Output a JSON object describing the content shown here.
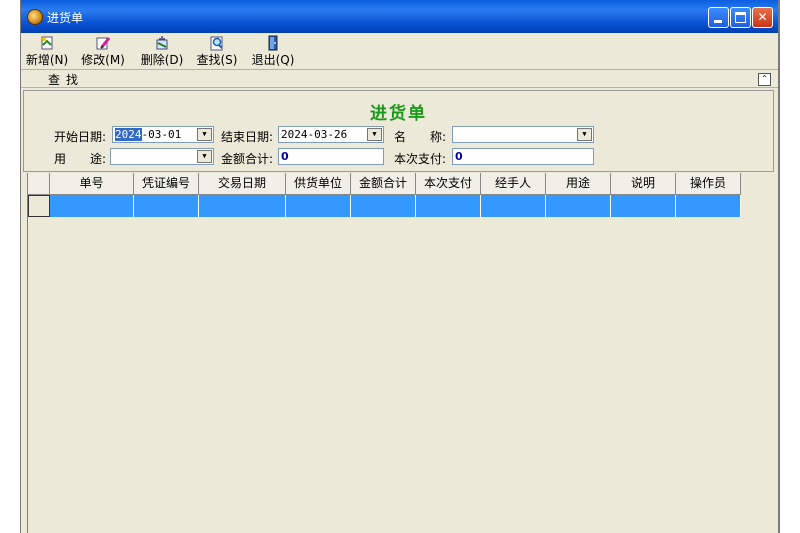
{
  "window": {
    "title": "进货单"
  },
  "toolbar": [
    {
      "name": "new",
      "label": "新增(N)",
      "icon": "new-doc-icon"
    },
    {
      "name": "edit",
      "label": "修改(M)",
      "icon": "edit-pencil-icon"
    },
    {
      "name": "delete",
      "label": "删除(D)",
      "icon": "delete-icon"
    },
    {
      "name": "search",
      "label": "查找(S)",
      "icon": "magnifier-icon"
    },
    {
      "name": "exit",
      "label": "退出(Q)",
      "icon": "exit-door-icon"
    }
  ],
  "search_strip": {
    "label": "查找"
  },
  "form": {
    "heading": "进货单",
    "start_date_label": "开始日期:",
    "start_date_sel": "2024",
    "start_date_rest": "-03-01",
    "end_date_label": "结束日期:",
    "end_date_value": "2024-03-26",
    "name_label": "名　　称:",
    "name_value": "",
    "purpose_label": "用　　途:",
    "purpose_value": "",
    "total_label": "金额合计:",
    "total_value": "0",
    "payment_label": "本次支付:",
    "payment_value": "0"
  },
  "table": {
    "columns": [
      "单号",
      "凭证编号",
      "交易日期",
      "供货单位",
      "金额合计",
      "本次支付",
      "经手人",
      "用途",
      "说明",
      "操作员"
    ]
  },
  "colors": {
    "selection": "#3399ff",
    "heading": "#1a9a1a",
    "titlebar": "#0a53d5"
  }
}
